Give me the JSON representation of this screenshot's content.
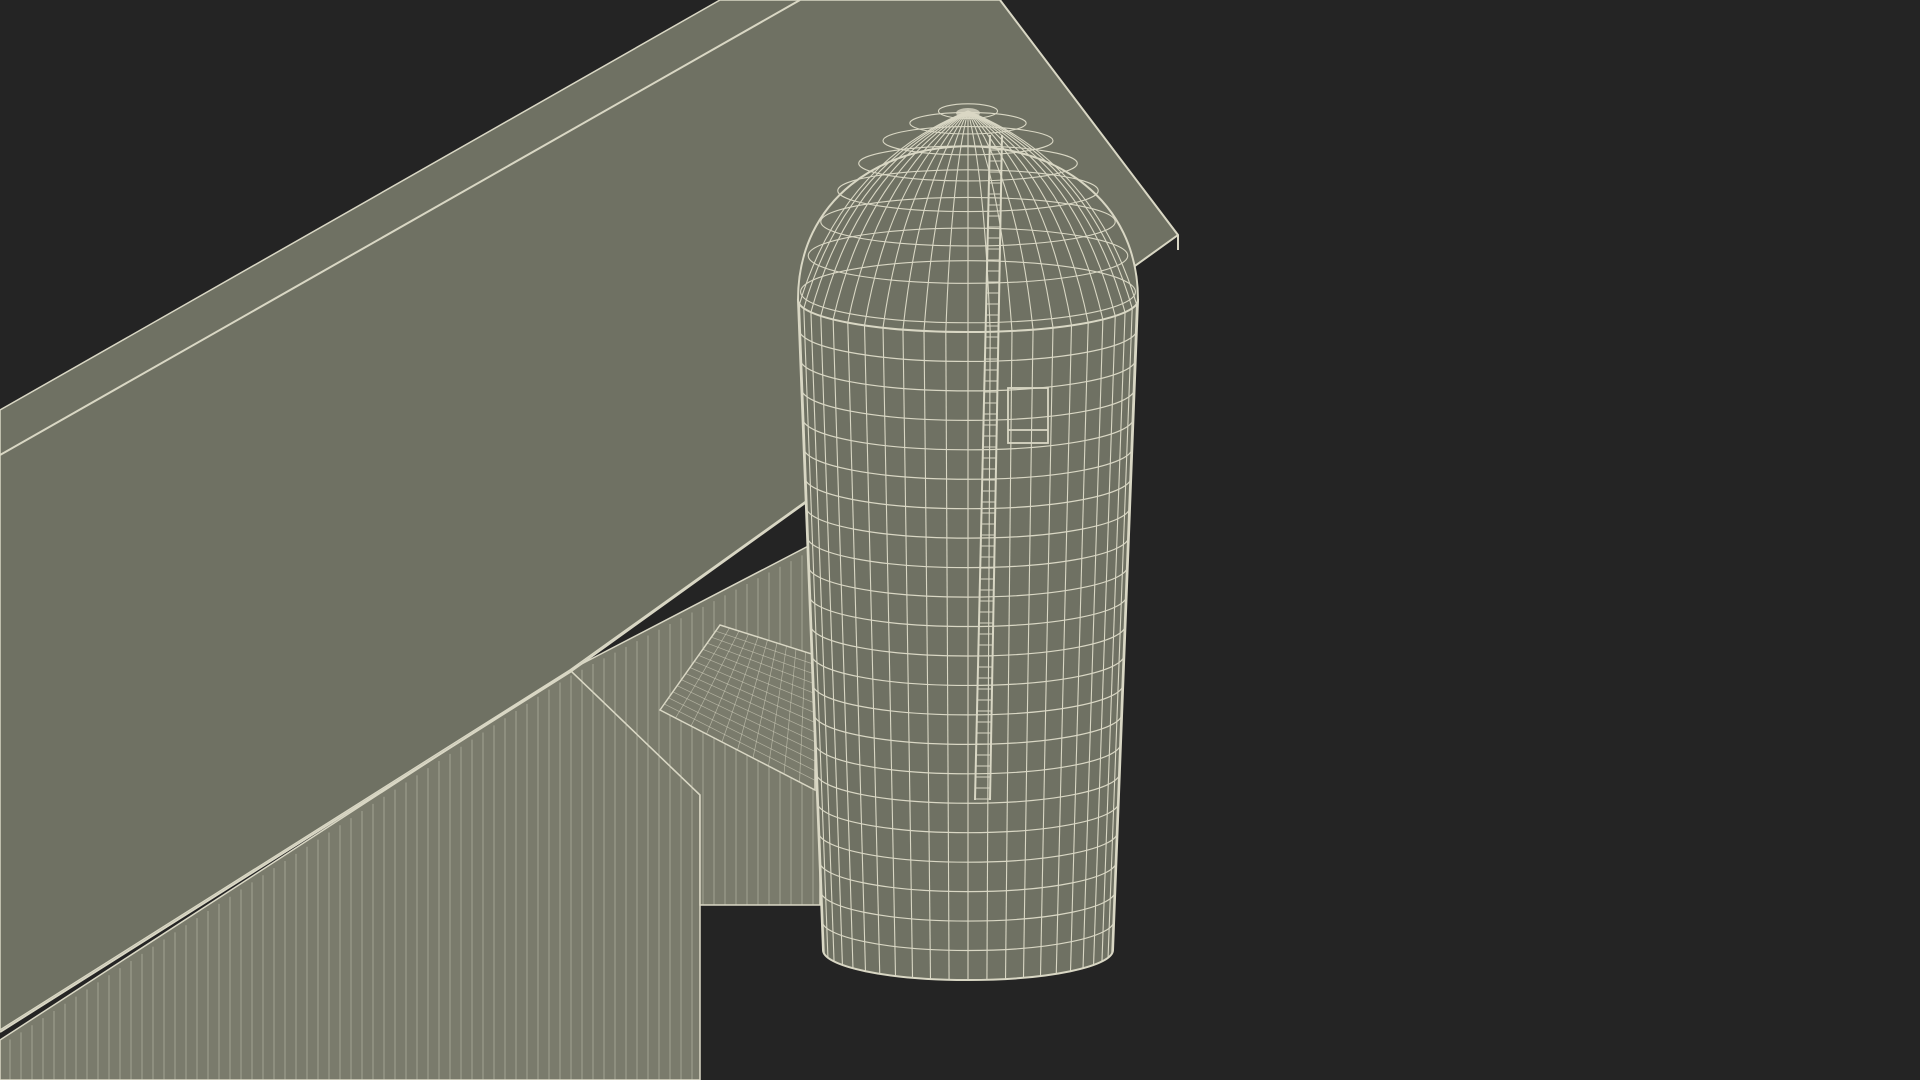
{
  "scene": {
    "background_color": "#242424",
    "surface_color": "#6f7163",
    "wire_color": "#d9d7c4",
    "wall_color": "#7a7b6c",
    "objects": [
      "barn-roof",
      "barn-side-wall",
      "lean-to-shed",
      "grain-silo",
      "silo-dome",
      "silo-ladder"
    ]
  }
}
